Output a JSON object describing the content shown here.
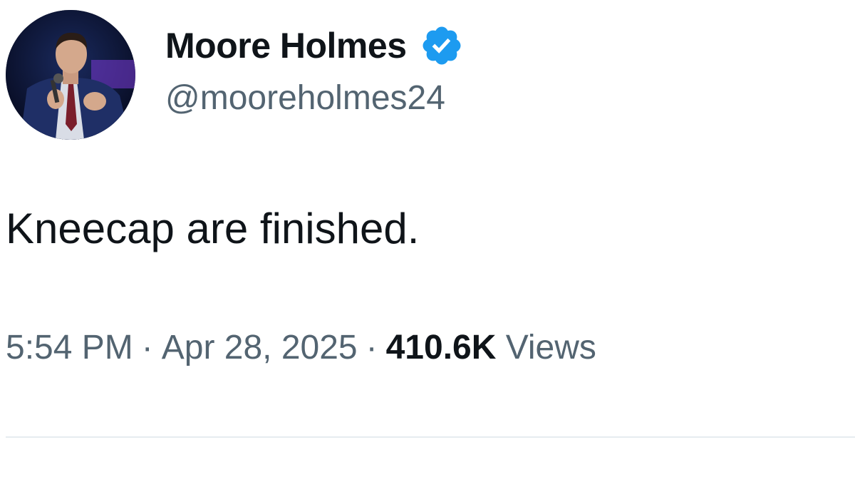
{
  "author": {
    "display_name": "Moore Holmes",
    "handle": "@mooreholmes24",
    "verified": true,
    "verified_badge_icon": "verified-check-icon",
    "verified_color": "#1d9bf0"
  },
  "tweet": {
    "text": "Kneecap are finished."
  },
  "meta": {
    "time": "5:54 PM",
    "separator": "·",
    "date": "Apr 28, 2025",
    "views_count": "410.6K",
    "views_label": "Views"
  },
  "colors": {
    "primary_text": "#0f1419",
    "secondary_text": "#536471",
    "divider": "#e6ecf0"
  }
}
